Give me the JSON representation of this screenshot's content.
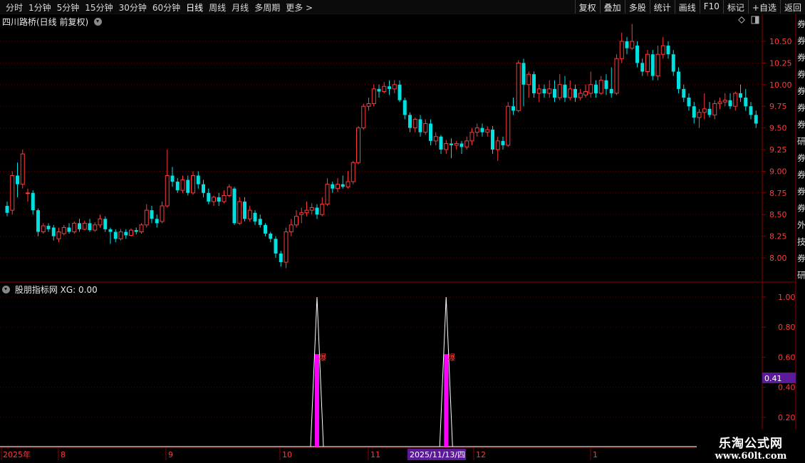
{
  "toolbar": {
    "periods": [
      "分时",
      "1分钟",
      "5分钟",
      "15分钟",
      "30分钟",
      "60分钟",
      "日线",
      "周线",
      "月线",
      "多周期",
      "更多 >"
    ],
    "active_period": "日线",
    "actions": [
      "复权",
      "叠加",
      "多股",
      "统计",
      "画线",
      "F10",
      "标记",
      "+自选",
      "返回"
    ]
  },
  "main_chart": {
    "title": "四川路桥(日线 前复权)",
    "y_ticks": [
      "10.50",
      "10.25",
      "10.00",
      "9.75",
      "9.50",
      "9.25",
      "9.00",
      "8.75",
      "8.50",
      "8.25",
      "8.00"
    ]
  },
  "indicator": {
    "title": "股朋指标网 XG: 0.00",
    "y_ticks": [
      "1.00",
      "0.80",
      "0.60",
      "0.40",
      "0.20"
    ],
    "value_label": "0.41",
    "signal_text": "爆"
  },
  "time_axis": {
    "labels": [
      "2025年",
      "8",
      "9",
      "10",
      "11",
      "12",
      "1"
    ],
    "cursor_date": "2025/11/13/四"
  },
  "watermark": {
    "line1": "乐淘公式网",
    "line2": "www.60lt.com"
  },
  "right_strip": {
    "chars": "券券券券券券券研券券券券外技券研"
  },
  "colors": {
    "up": "#ff3b3b",
    "down": "#00e0e0",
    "signal": "#ff00ff",
    "grid": "#5a0000"
  },
  "chart_data": {
    "type": "candlestick",
    "price_range": [
      7.8,
      10.7
    ],
    "indicator_range": [
      0,
      1
    ],
    "signal_bars": [
      60,
      85
    ],
    "candles": [
      [
        8.6,
        8.52,
        8.65,
        8.48
      ],
      [
        8.55,
        8.95,
        9.0,
        8.5
      ],
      [
        8.95,
        8.85,
        9.1,
        8.7
      ],
      [
        8.85,
        9.2,
        9.25,
        8.8
      ],
      [
        8.75,
        8.75,
        8.8,
        8.65
      ],
      [
        8.75,
        8.55,
        8.78,
        8.5
      ],
      [
        8.55,
        8.3,
        8.57,
        8.25
      ],
      [
        8.3,
        8.37,
        8.4,
        8.28
      ],
      [
        8.37,
        8.33,
        8.4,
        8.3
      ],
      [
        8.35,
        8.25,
        8.38,
        8.2
      ],
      [
        8.22,
        8.3,
        8.35,
        8.18
      ],
      [
        8.28,
        8.35,
        8.38,
        8.26
      ],
      [
        8.35,
        8.3,
        8.4,
        8.28
      ],
      [
        8.3,
        8.4,
        8.42,
        8.28
      ],
      [
        8.4,
        8.33,
        8.45,
        8.3
      ],
      [
        8.33,
        8.4,
        8.43,
        8.32
      ],
      [
        8.4,
        8.32,
        8.45,
        8.3
      ],
      [
        8.32,
        8.38,
        8.41,
        8.3
      ],
      [
        8.38,
        8.45,
        8.5,
        8.35
      ],
      [
        8.45,
        8.33,
        8.48,
        8.3
      ],
      [
        8.33,
        8.3,
        8.35,
        8.16
      ],
      [
        8.3,
        8.22,
        8.33,
        8.18
      ],
      [
        8.22,
        8.3,
        8.33,
        8.2
      ],
      [
        8.3,
        8.26,
        8.33,
        8.22
      ],
      [
        8.26,
        8.32,
        8.34,
        8.25
      ],
      [
        8.32,
        8.3,
        8.35,
        8.27
      ],
      [
        8.3,
        8.38,
        8.4,
        8.28
      ],
      [
        8.38,
        8.55,
        8.62,
        8.35
      ],
      [
        8.55,
        8.45,
        8.6,
        8.4
      ],
      [
        8.45,
        8.4,
        8.5,
        8.35
      ],
      [
        8.42,
        8.6,
        8.65,
        8.4
      ],
      [
        8.6,
        8.95,
        9.25,
        8.58
      ],
      [
        8.95,
        8.88,
        9.05,
        8.82
      ],
      [
        8.88,
        8.78,
        8.92,
        8.75
      ],
      [
        8.78,
        8.9,
        8.95,
        8.75
      ],
      [
        8.9,
        8.75,
        8.95,
        8.72
      ],
      [
        8.75,
        8.95,
        9.0,
        8.73
      ],
      [
        8.95,
        8.85,
        9.0,
        8.8
      ],
      [
        8.85,
        8.75,
        8.9,
        8.7
      ],
      [
        8.75,
        8.65,
        8.8,
        8.62
      ],
      [
        8.65,
        8.7,
        8.72,
        8.6
      ],
      [
        8.7,
        8.65,
        8.75,
        8.6
      ],
      [
        8.65,
        8.72,
        8.78,
        8.63
      ],
      [
        8.72,
        8.82,
        8.85,
        8.7
      ],
      [
        8.8,
        8.4,
        8.82,
        8.38
      ],
      [
        8.4,
        8.65,
        8.7,
        8.38
      ],
      [
        8.65,
        8.45,
        8.7,
        8.42
      ],
      [
        8.45,
        8.55,
        8.6,
        8.42
      ],
      [
        8.52,
        8.42,
        8.55,
        8.38
      ],
      [
        8.45,
        8.38,
        8.5,
        8.35
      ],
      [
        8.38,
        8.28,
        8.4,
        8.25
      ],
      [
        8.28,
        8.22,
        8.3,
        8.18
      ],
      [
        8.22,
        8.05,
        8.25,
        8.0
      ],
      [
        8.05,
        7.95,
        8.08,
        7.9
      ],
      [
        7.95,
        8.3,
        8.35,
        7.88
      ],
      [
        8.3,
        8.38,
        8.45,
        8.25
      ],
      [
        8.38,
        8.48,
        8.55,
        8.35
      ],
      [
        8.5,
        8.52,
        8.58,
        8.4
      ],
      [
        8.52,
        8.55,
        8.65,
        8.48
      ],
      [
        8.55,
        8.58,
        8.63,
        8.5
      ],
      [
        8.58,
        8.5,
        8.62,
        8.45
      ],
      [
        8.5,
        8.62,
        8.7,
        8.48
      ],
      [
        8.62,
        8.85,
        8.92,
        8.6
      ],
      [
        8.85,
        8.8,
        8.88,
        8.75
      ],
      [
        8.8,
        8.85,
        8.92,
        8.76
      ],
      [
        8.85,
        8.82,
        8.95,
        8.8
      ],
      [
        8.82,
        8.88,
        9.0,
        8.8
      ],
      [
        8.88,
        9.1,
        9.12,
        8.85
      ],
      [
        9.1,
        9.5,
        9.52,
        9.08
      ],
      [
        9.5,
        9.75,
        9.78,
        9.48
      ],
      [
        9.75,
        9.78,
        9.85,
        9.7
      ],
      [
        9.78,
        9.95,
        10.0,
        9.75
      ],
      [
        9.95,
        9.92,
        10.0,
        9.85
      ],
      [
        9.92,
        9.98,
        10.03,
        9.9
      ],
      [
        9.98,
        9.95,
        10.05,
        9.88
      ],
      [
        9.95,
        10.0,
        10.05,
        9.9
      ],
      [
        10.0,
        9.82,
        10.05,
        9.8
      ],
      [
        9.82,
        9.65,
        9.85,
        9.6
      ],
      [
        9.65,
        9.5,
        9.68,
        9.45
      ],
      [
        9.5,
        9.6,
        9.62,
        9.45
      ],
      [
        9.6,
        9.45,
        9.65,
        9.4
      ],
      [
        9.45,
        9.55,
        9.6,
        9.42
      ],
      [
        9.55,
        9.35,
        9.6,
        9.3
      ],
      [
        9.35,
        9.4,
        9.45,
        9.3
      ],
      [
        9.4,
        9.25,
        9.42,
        9.2
      ],
      [
        9.25,
        9.32,
        9.36,
        9.2
      ],
      [
        9.32,
        9.3,
        9.38,
        9.15
      ],
      [
        9.3,
        9.32,
        9.35,
        9.25
      ],
      [
        9.32,
        9.28,
        9.35,
        9.2
      ],
      [
        9.28,
        9.35,
        9.4,
        9.25
      ],
      [
        9.35,
        9.45,
        9.5,
        9.3
      ],
      [
        9.45,
        9.5,
        9.55,
        9.4
      ],
      [
        9.5,
        9.45,
        9.55,
        9.4
      ],
      [
        9.45,
        9.48,
        9.52,
        9.4
      ],
      [
        9.48,
        9.25,
        9.52,
        9.2
      ],
      [
        9.25,
        9.35,
        9.4,
        9.12
      ],
      [
        9.35,
        9.3,
        9.4,
        9.25
      ],
      [
        9.3,
        9.75,
        9.8,
        9.28
      ],
      [
        9.75,
        9.7,
        9.85,
        9.65
      ],
      [
        9.7,
        10.25,
        10.28,
        9.68
      ],
      [
        10.25,
        10.0,
        10.3,
        9.75
      ],
      [
        10.0,
        10.12,
        10.15,
        9.85
      ],
      [
        10.12,
        9.9,
        10.15,
        9.85
      ],
      [
        9.9,
        9.95,
        10.0,
        9.8
      ],
      [
        9.95,
        9.9,
        10.0,
        9.85
      ],
      [
        9.9,
        9.95,
        10.05,
        9.85
      ],
      [
        9.95,
        9.85,
        10.05,
        9.8
      ],
      [
        9.85,
        10.0,
        10.12,
        9.82
      ],
      [
        10.0,
        9.85,
        10.1,
        9.8
      ],
      [
        9.85,
        9.95,
        10.05,
        9.82
      ],
      [
        9.95,
        9.85,
        10.0,
        9.8
      ],
      [
        9.85,
        9.9,
        9.95,
        9.82
      ],
      [
        9.88,
        9.92,
        10.0,
        9.85
      ],
      [
        9.9,
        10.0,
        10.15,
        9.85
      ],
      [
        10.0,
        9.9,
        10.05,
        9.85
      ],
      [
        9.9,
        10.05,
        10.1,
        9.88
      ],
      [
        10.05,
        9.95,
        10.12,
        9.88
      ],
      [
        9.95,
        9.9,
        10.2,
        9.85
      ],
      [
        9.9,
        10.3,
        10.35,
        9.88
      ],
      [
        10.3,
        10.5,
        10.6,
        10.25
      ],
      [
        10.5,
        10.42,
        10.55,
        10.35
      ],
      [
        10.42,
        10.5,
        10.7,
        10.4
      ],
      [
        10.45,
        10.25,
        10.5,
        10.2
      ],
      [
        10.25,
        10.15,
        10.3,
        10.1
      ],
      [
        10.15,
        10.35,
        10.4,
        10.1
      ],
      [
        10.35,
        10.1,
        10.4,
        10.05
      ],
      [
        10.1,
        10.35,
        10.45,
        10.05
      ],
      [
        10.35,
        10.45,
        10.55,
        10.3
      ],
      [
        10.45,
        10.35,
        10.5,
        10.3
      ],
      [
        10.35,
        10.15,
        10.4,
        10.1
      ],
      [
        10.15,
        9.95,
        10.2,
        9.9
      ],
      [
        9.95,
        9.85,
        10.0,
        9.8
      ],
      [
        9.85,
        9.75,
        9.9,
        9.7
      ],
      [
        9.75,
        9.62,
        9.8,
        9.55
      ],
      [
        9.62,
        9.68,
        9.72,
        9.5
      ],
      [
        9.68,
        9.72,
        9.9,
        9.6
      ],
      [
        9.72,
        9.65,
        9.8,
        9.62
      ],
      [
        9.65,
        9.78,
        9.82,
        9.6
      ],
      [
        9.78,
        9.8,
        9.85,
        9.72
      ],
      [
        9.8,
        9.82,
        9.9,
        9.75
      ],
      [
        9.82,
        9.75,
        9.9,
        9.72
      ],
      [
        9.75,
        9.9,
        9.92,
        9.7
      ],
      [
        9.9,
        9.85,
        10.0,
        9.8
      ],
      [
        9.85,
        9.75,
        9.95,
        9.7
      ],
      [
        9.75,
        9.65,
        9.8,
        9.6
      ],
      [
        9.65,
        9.55,
        9.7,
        9.5
      ]
    ]
  }
}
